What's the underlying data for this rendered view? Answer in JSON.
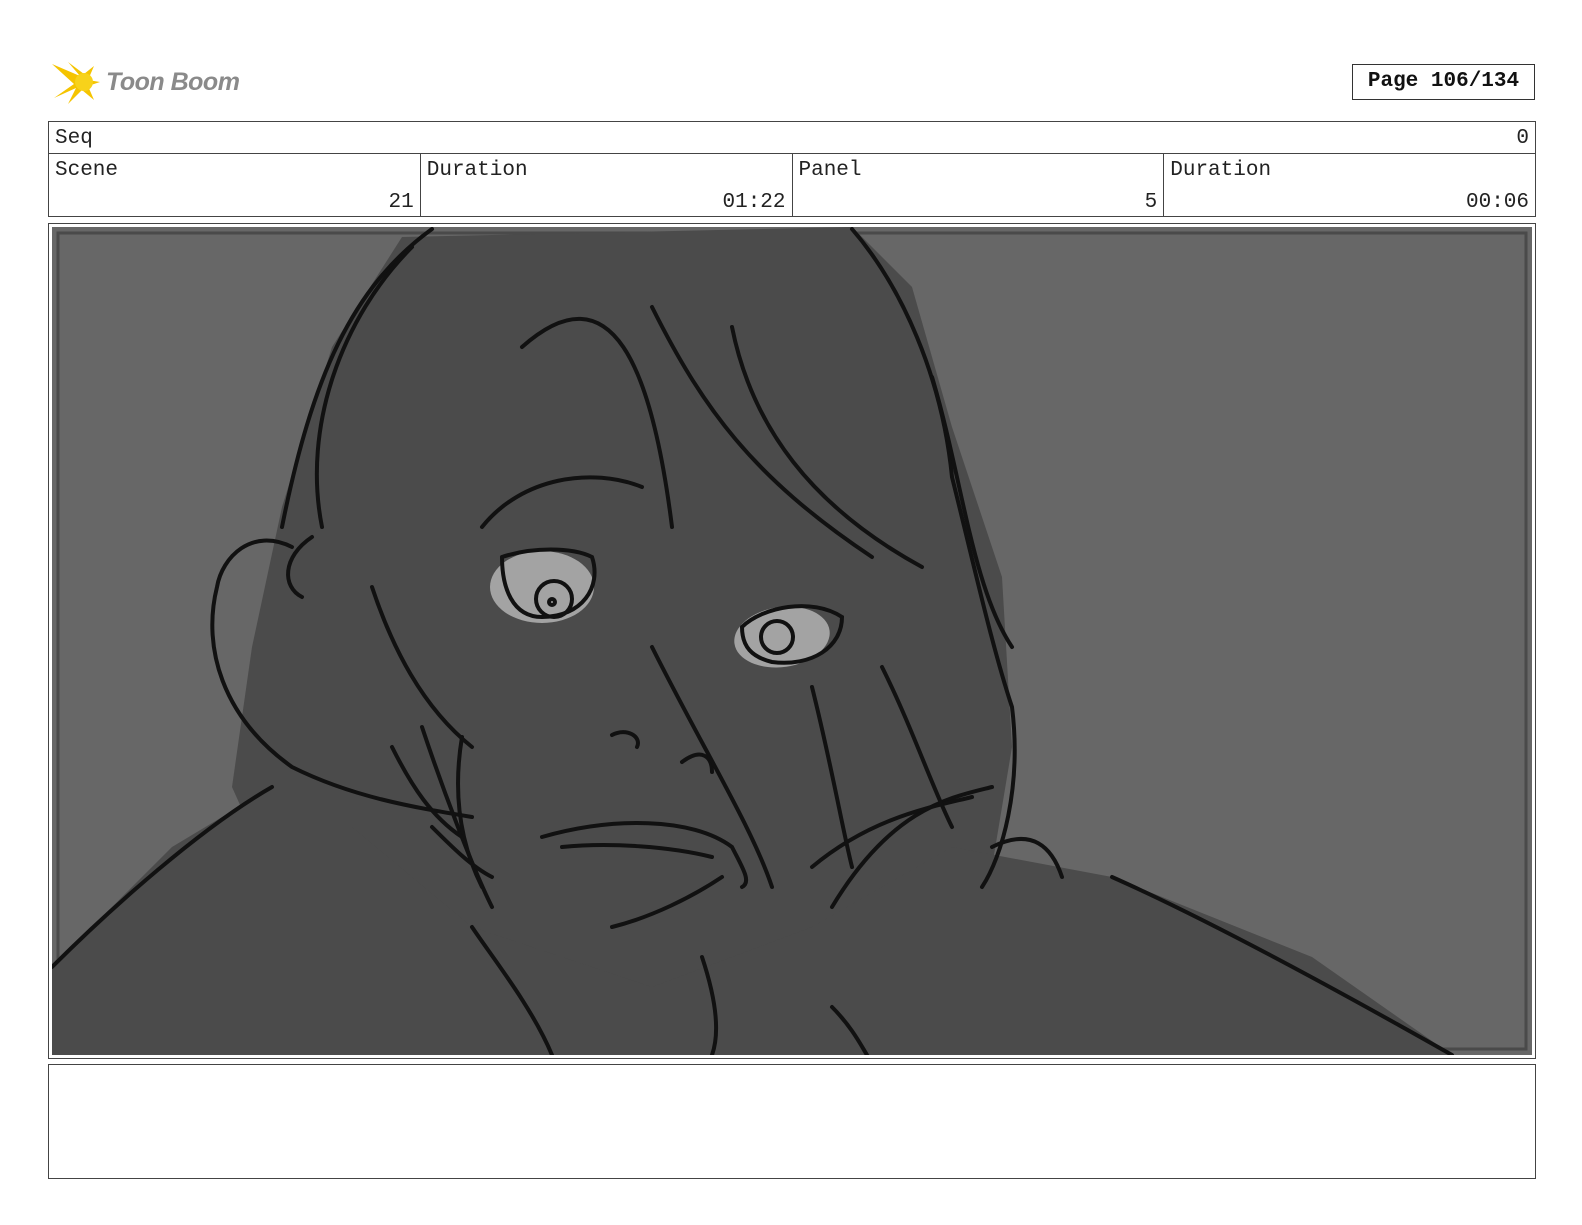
{
  "header": {
    "logo_text": "Toon Boom",
    "page_label": "Page 106/134"
  },
  "sequence": {
    "label": "Seq",
    "value": "0"
  },
  "fields": [
    {
      "label": "Scene",
      "value": "21"
    },
    {
      "label": "Duration",
      "value": "01:22"
    },
    {
      "label": "Panel",
      "value": "5"
    },
    {
      "label": "Duration",
      "value": "00:06"
    }
  ],
  "colors": {
    "logo_accent": "#f5c400",
    "panel_background": "#676767",
    "character_fill": "#4b4b4b",
    "eye_fill": "#a3a3a3"
  },
  "notes": {
    "text": ""
  }
}
